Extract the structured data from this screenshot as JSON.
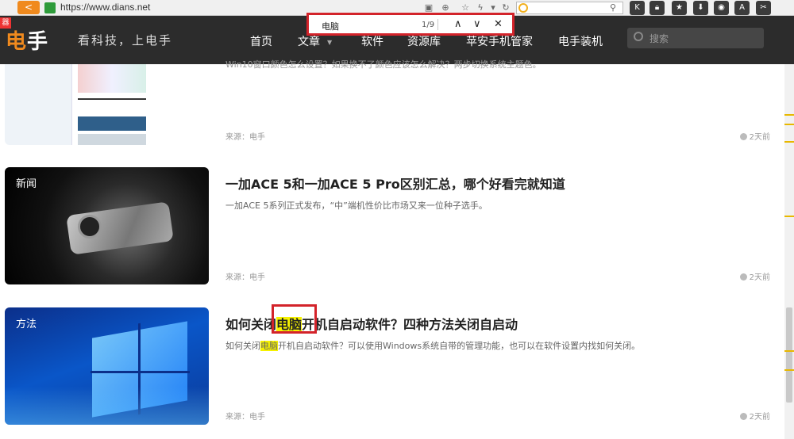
{
  "browser": {
    "url": "https://www.dians.net",
    "back_icon": "back-arrow-icon",
    "extensions": [
      "K",
      "lock",
      "star",
      "download",
      "game",
      "A",
      "scissors"
    ]
  },
  "site": {
    "logo_part1": "电",
    "logo_part2": "手",
    "slogan": "看科技，上电手",
    "red_tag": "器",
    "nav": [
      {
        "label": "首页"
      },
      {
        "label": "文章"
      },
      {
        "label": "软件"
      },
      {
        "label": "资源库"
      },
      {
        "label": "苹安手机管家"
      },
      {
        "label": "电手装机"
      }
    ],
    "search_placeholder": "搜索"
  },
  "findbar": {
    "query": "电脑",
    "count": "1/9"
  },
  "articles": [
    {
      "title": "Win10窗口颜色怎么设置？如果换不了颜色应该怎么解决？两步切换系统主题色。",
      "source": "来源：电手",
      "time": "2天前"
    },
    {
      "tag": "新闻",
      "title": "一加ACE 5和一加ACE 5 Pro区别汇总，哪个好看完就知道",
      "desc": "一加ACE 5系列正式发布，“中”端机性价比市场又来一位种子选手。",
      "source": "来源：电手",
      "time": "2天前"
    },
    {
      "tag": "方法",
      "title_pre": "如何关闭",
      "title_hl": "电脑",
      "title_post": "开机自启动软件？四种方法关闭自启动",
      "desc_pre": "如何关闭",
      "desc_hl": "电脑",
      "desc_post": "开机自启动软件？可以使用Windows系统自带的管理功能，也可以在软件设置内找如何关闭。",
      "source": "来源：电手",
      "time": "2天前"
    }
  ],
  "colors": {
    "nav_bg": "#2c2c2c",
    "accent": "#f08a1e",
    "highlight": "#f6f200",
    "annotation": "#d3232a"
  }
}
